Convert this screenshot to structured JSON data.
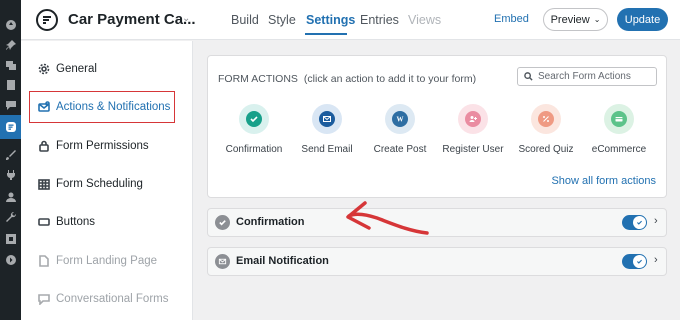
{
  "wp_menu": {
    "icons": [
      "pin-icon",
      "media-icon",
      "pages-icon",
      "comments-icon",
      "forms-icon",
      "appearance-icon",
      "plugins-icon",
      "users-icon",
      "tools-icon",
      "settings-icon",
      "collapse-icon"
    ],
    "active": "forms-icon"
  },
  "header": {
    "form_title": "Car Payment Ca...",
    "tabs": [
      {
        "label": "Build"
      },
      {
        "label": "Style"
      },
      {
        "label": "Settings"
      },
      {
        "label": "Entries"
      },
      {
        "label": "Views"
      }
    ],
    "active_tab": "Settings",
    "embed_label": "Embed",
    "preview_label": "Preview",
    "update_label": "Update"
  },
  "sidebar": {
    "items": [
      {
        "label": "General",
        "icon": "gear-icon"
      },
      {
        "label": "Actions & Notifications",
        "icon": "actions-icon"
      },
      {
        "label": "Form Permissions",
        "icon": "lock-icon"
      },
      {
        "label": "Form Scheduling",
        "icon": "calendar-icon"
      },
      {
        "label": "Buttons",
        "icon": "button-icon"
      },
      {
        "label": "Form Landing Page",
        "icon": "page-icon"
      },
      {
        "label": "Conversational Forms",
        "icon": "chat-icon"
      }
    ],
    "selected": "Actions & Notifications"
  },
  "form_actions": {
    "heading": "FORM ACTIONS",
    "subheading": "(click an action to add it to your form)",
    "search_placeholder": "Search Form Actions",
    "actions": [
      {
        "label": "Confirmation",
        "icon": "check-icon",
        "bg": "#d9f1ee",
        "fg": "#18a08a"
      },
      {
        "label": "Send Email",
        "icon": "envelope-icon",
        "bg": "#d9e6f4",
        "fg": "#1b5c9e"
      },
      {
        "label": "Create Post",
        "icon": "wordpress-icon",
        "bg": "#dde9f3",
        "fg": "#2e6ea3"
      },
      {
        "label": "Register User",
        "icon": "add-user-icon",
        "bg": "#fbe2e7",
        "fg": "#ea8ca1"
      },
      {
        "label": "Scored Quiz",
        "icon": "percent-icon",
        "bg": "#fbe6df",
        "fg": "#ef9a83"
      },
      {
        "label": "eCommerce",
        "icon": "card-icon",
        "bg": "#dcf2e4",
        "fg": "#5cc38a"
      }
    ],
    "show_all_label": "Show all form actions"
  },
  "action_rows": [
    {
      "label": "Confirmation",
      "icon": "check-icon",
      "enabled": true
    },
    {
      "label": "Email Notification",
      "icon": "envelope-icon",
      "enabled": true
    }
  ],
  "colors": {
    "accent": "#2271b1",
    "highlight": "#d63638"
  }
}
